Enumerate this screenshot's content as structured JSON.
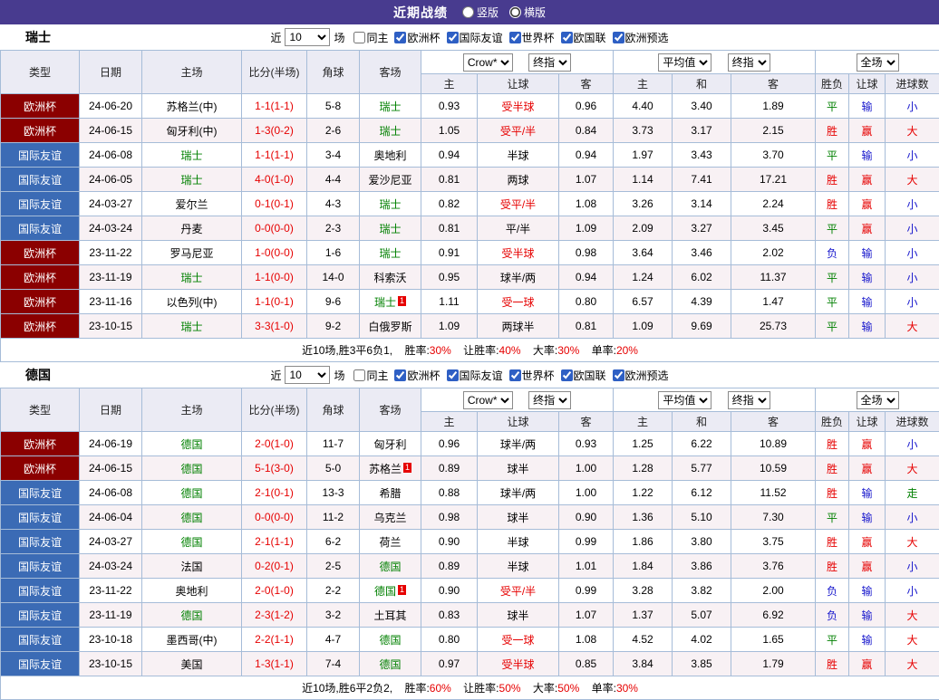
{
  "titlebar": {
    "title": "近期战绩",
    "view_options": [
      {
        "label": "竖版",
        "checked": false
      },
      {
        "label": "横版",
        "checked": true
      }
    ]
  },
  "filter_labels": {
    "recent": "近",
    "games": "场"
  },
  "selects": {
    "recent_count": "10",
    "bookmaker": "Crow*",
    "bookmaker_final": "终指",
    "average": "平均值",
    "average_final": "终指",
    "scope": "全场"
  },
  "table_headers": {
    "type": "类型",
    "date": "日期",
    "home": "主场",
    "score": "比分(半场)",
    "corner": "角球",
    "away": "客场",
    "odds_home": "主",
    "odds_handicap": "让球",
    "odds_away": "客",
    "avg_home": "主",
    "avg_draw": "和",
    "avg_away": "客",
    "result": "胜负",
    "handicap_result": "让球",
    "goals": "进球数"
  },
  "comp_colors": {
    "欧洲杯": "#8B0000",
    "国际友谊": "#3B6BB5"
  },
  "result_colors": {
    "win": "#E60000",
    "draw": "#008000",
    "lose": "#1515CC"
  },
  "sections": [
    {
      "team": "瑞士",
      "filters": [
        {
          "label": "同主",
          "checked": false
        },
        {
          "label": "欧洲杯",
          "checked": true
        },
        {
          "label": "国际友谊",
          "checked": true
        },
        {
          "label": "世界杯",
          "checked": true
        },
        {
          "label": "欧国联",
          "checked": true
        },
        {
          "label": "欧洲预选",
          "checked": true
        }
      ],
      "rows": [
        {
          "comp": "欧洲杯",
          "date": "24-06-20",
          "home": "苏格兰(中)",
          "score": "1-1(1-1)",
          "corner": "5-8",
          "away": "瑞士",
          "away_focus": true,
          "odds_home": "0.93",
          "handicap": "受半球",
          "handicap_recv": true,
          "odds_away": "0.96",
          "avg_home": "4.40",
          "avg_draw": "3.40",
          "avg_away": "1.89",
          "result": "平",
          "result_k": "draw",
          "asian": "输",
          "asian_k": "lose",
          "goals": "小",
          "goals_k": "lose"
        },
        {
          "comp": "欧洲杯",
          "date": "24-06-15",
          "home": "匈牙利(中)",
          "score": "1-3(0-2)",
          "corner": "2-6",
          "away": "瑞士",
          "away_focus": true,
          "odds_home": "1.05",
          "handicap": "受平/半",
          "handicap_recv": true,
          "odds_away": "0.84",
          "avg_home": "3.73",
          "avg_draw": "3.17",
          "avg_away": "2.15",
          "result": "胜",
          "result_k": "win",
          "asian": "赢",
          "asian_k": "win",
          "goals": "大",
          "goals_k": "win"
        },
        {
          "comp": "国际友谊",
          "date": "24-06-08",
          "home": "瑞士",
          "home_focus": true,
          "score": "1-1(1-1)",
          "corner": "3-4",
          "away": "奥地利",
          "odds_home": "0.94",
          "handicap": "半球",
          "odds_away": "0.94",
          "avg_home": "1.97",
          "avg_draw": "3.43",
          "avg_away": "3.70",
          "result": "平",
          "result_k": "draw",
          "asian": "输",
          "asian_k": "lose",
          "goals": "小",
          "goals_k": "lose"
        },
        {
          "comp": "国际友谊",
          "date": "24-06-05",
          "home": "瑞士",
          "home_focus": true,
          "score": "4-0(1-0)",
          "corner": "4-4",
          "away": "爱沙尼亚",
          "odds_home": "0.81",
          "handicap": "两球",
          "odds_away": "1.07",
          "avg_home": "1.14",
          "avg_draw": "7.41",
          "avg_away": "17.21",
          "result": "胜",
          "result_k": "win",
          "asian": "赢",
          "asian_k": "win",
          "goals": "大",
          "goals_k": "win"
        },
        {
          "comp": "国际友谊",
          "date": "24-03-27",
          "home": "爱尔兰",
          "score": "0-1(0-1)",
          "corner": "4-3",
          "away": "瑞士",
          "away_focus": true,
          "odds_home": "0.82",
          "handicap": "受平/半",
          "handicap_recv": true,
          "odds_away": "1.08",
          "avg_home": "3.26",
          "avg_draw": "3.14",
          "avg_away": "2.24",
          "result": "胜",
          "result_k": "win",
          "asian": "赢",
          "asian_k": "win",
          "goals": "小",
          "goals_k": "lose"
        },
        {
          "comp": "国际友谊",
          "date": "24-03-24",
          "home": "丹麦",
          "score": "0-0(0-0)",
          "corner": "2-3",
          "away": "瑞士",
          "away_focus": true,
          "odds_home": "0.81",
          "handicap": "平/半",
          "odds_away": "1.09",
          "avg_home": "2.09",
          "avg_draw": "3.27",
          "avg_away": "3.45",
          "result": "平",
          "result_k": "draw",
          "asian": "赢",
          "asian_k": "win",
          "goals": "小",
          "goals_k": "lose"
        },
        {
          "comp": "欧洲杯",
          "date": "23-11-22",
          "home": "罗马尼亚",
          "score": "1-0(0-0)",
          "corner": "1-6",
          "away": "瑞士",
          "away_focus": true,
          "odds_home": "0.91",
          "handicap": "受半球",
          "handicap_recv": true,
          "odds_away": "0.98",
          "avg_home": "3.64",
          "avg_draw": "3.46",
          "avg_away": "2.02",
          "result": "负",
          "result_k": "lose",
          "asian": "输",
          "asian_k": "lose",
          "goals": "小",
          "goals_k": "lose"
        },
        {
          "comp": "欧洲杯",
          "date": "23-11-19",
          "home": "瑞士",
          "home_focus": true,
          "score": "1-1(0-0)",
          "corner": "14-0",
          "away": "科索沃",
          "odds_home": "0.95",
          "handicap": "球半/两",
          "odds_away": "0.94",
          "avg_home": "1.24",
          "avg_draw": "6.02",
          "avg_away": "11.37",
          "result": "平",
          "result_k": "draw",
          "asian": "输",
          "asian_k": "lose",
          "goals": "小",
          "goals_k": "lose"
        },
        {
          "comp": "欧洲杯",
          "date": "23-11-16",
          "home": "以色列(中)",
          "score": "1-1(0-1)",
          "corner": "9-6",
          "away": "瑞士",
          "away_focus": true,
          "away_badge": "1",
          "odds_home": "1.11",
          "handicap": "受一球",
          "handicap_recv": true,
          "odds_away": "0.80",
          "avg_home": "6.57",
          "avg_draw": "4.39",
          "avg_away": "1.47",
          "result": "平",
          "result_k": "draw",
          "asian": "输",
          "asian_k": "lose",
          "goals": "小",
          "goals_k": "lose"
        },
        {
          "comp": "欧洲杯",
          "date": "23-10-15",
          "home": "瑞士",
          "home_focus": true,
          "score": "3-3(1-0)",
          "corner": "9-2",
          "away": "白俄罗斯",
          "odds_home": "1.09",
          "handicap": "两球半",
          "odds_away": "0.81",
          "avg_home": "1.09",
          "avg_draw": "9.69",
          "avg_away": "25.73",
          "result": "平",
          "result_k": "draw",
          "asian": "输",
          "asian_k": "lose",
          "goals": "大",
          "goals_k": "win"
        }
      ],
      "footer": {
        "summary": "近10场,胜3平6负1,",
        "stats": [
          {
            "label": "胜率:",
            "value": "30%"
          },
          {
            "label": "让胜率:",
            "value": "40%"
          },
          {
            "label": "大率:",
            "value": "30%"
          },
          {
            "label": "单率:",
            "value": "20%"
          }
        ]
      }
    },
    {
      "team": "德国",
      "filters": [
        {
          "label": "同主",
          "checked": false
        },
        {
          "label": "欧洲杯",
          "checked": true
        },
        {
          "label": "国际友谊",
          "checked": true
        },
        {
          "label": "世界杯",
          "checked": true
        },
        {
          "label": "欧国联",
          "checked": true
        },
        {
          "label": "欧洲预选",
          "checked": true
        }
      ],
      "rows": [
        {
          "comp": "欧洲杯",
          "date": "24-06-19",
          "home": "德国",
          "home_focus": true,
          "score": "2-0(1-0)",
          "corner": "11-7",
          "away": "匈牙利",
          "odds_home": "0.96",
          "handicap": "球半/两",
          "odds_away": "0.93",
          "avg_home": "1.25",
          "avg_draw": "6.22",
          "avg_away": "10.89",
          "result": "胜",
          "result_k": "win",
          "asian": "赢",
          "asian_k": "win",
          "goals": "小",
          "goals_k": "lose"
        },
        {
          "comp": "欧洲杯",
          "date": "24-06-15",
          "home": "德国",
          "home_focus": true,
          "score": "5-1(3-0)",
          "corner": "5-0",
          "away": "苏格兰",
          "away_badge": "1",
          "odds_home": "0.89",
          "handicap": "球半",
          "odds_away": "1.00",
          "avg_home": "1.28",
          "avg_draw": "5.77",
          "avg_away": "10.59",
          "result": "胜",
          "result_k": "win",
          "asian": "赢",
          "asian_k": "win",
          "goals": "大",
          "goals_k": "win"
        },
        {
          "comp": "国际友谊",
          "date": "24-06-08",
          "home": "德国",
          "home_focus": true,
          "score": "2-1(0-1)",
          "corner": "13-3",
          "away": "希腊",
          "odds_home": "0.88",
          "handicap": "球半/两",
          "odds_away": "1.00",
          "avg_home": "1.22",
          "avg_draw": "6.12",
          "avg_away": "11.52",
          "result": "胜",
          "result_k": "win",
          "asian": "输",
          "asian_k": "lose",
          "goals": "走",
          "goals_k": "draw"
        },
        {
          "comp": "国际友谊",
          "date": "24-06-04",
          "home": "德国",
          "home_focus": true,
          "score": "0-0(0-0)",
          "corner": "11-2",
          "away": "乌克兰",
          "odds_home": "0.98",
          "handicap": "球半",
          "odds_away": "0.90",
          "avg_home": "1.36",
          "avg_draw": "5.10",
          "avg_away": "7.30",
          "result": "平",
          "result_k": "draw",
          "asian": "输",
          "asian_k": "lose",
          "goals": "小",
          "goals_k": "lose"
        },
        {
          "comp": "国际友谊",
          "date": "24-03-27",
          "home": "德国",
          "home_focus": true,
          "score": "2-1(1-1)",
          "corner": "6-2",
          "away": "荷兰",
          "odds_home": "0.90",
          "handicap": "半球",
          "odds_away": "0.99",
          "avg_home": "1.86",
          "avg_draw": "3.80",
          "avg_away": "3.75",
          "result": "胜",
          "result_k": "win",
          "asian": "赢",
          "asian_k": "win",
          "goals": "大",
          "goals_k": "win"
        },
        {
          "comp": "国际友谊",
          "date": "24-03-24",
          "home": "法国",
          "score": "0-2(0-1)",
          "corner": "2-5",
          "away": "德国",
          "away_focus": true,
          "odds_home": "0.89",
          "handicap": "半球",
          "odds_away": "1.01",
          "avg_home": "1.84",
          "avg_draw": "3.86",
          "avg_away": "3.76",
          "result": "胜",
          "result_k": "win",
          "asian": "赢",
          "asian_k": "win",
          "goals": "小",
          "goals_k": "lose"
        },
        {
          "comp": "国际友谊",
          "date": "23-11-22",
          "home": "奥地利",
          "score": "2-0(1-0)",
          "corner": "2-2",
          "away": "德国",
          "away_focus": true,
          "away_badge": "1",
          "odds_home": "0.90",
          "handicap": "受平/半",
          "handicap_recv": true,
          "odds_away": "0.99",
          "avg_home": "3.28",
          "avg_draw": "3.82",
          "avg_away": "2.00",
          "result": "负",
          "result_k": "lose",
          "asian": "输",
          "asian_k": "lose",
          "goals": "小",
          "goals_k": "lose"
        },
        {
          "comp": "国际友谊",
          "date": "23-11-19",
          "home": "德国",
          "home_focus": true,
          "score": "2-3(1-2)",
          "corner": "3-2",
          "away": "土耳其",
          "odds_home": "0.83",
          "handicap": "球半",
          "odds_away": "1.07",
          "avg_home": "1.37",
          "avg_draw": "5.07",
          "avg_away": "6.92",
          "result": "负",
          "result_k": "lose",
          "asian": "输",
          "asian_k": "lose",
          "goals": "大",
          "goals_k": "win"
        },
        {
          "comp": "国际友谊",
          "date": "23-10-18",
          "home": "墨西哥(中)",
          "score": "2-2(1-1)",
          "corner": "4-7",
          "away": "德国",
          "away_focus": true,
          "odds_home": "0.80",
          "handicap": "受一球",
          "handicap_recv": true,
          "odds_away": "1.08",
          "avg_home": "4.52",
          "avg_draw": "4.02",
          "avg_away": "1.65",
          "result": "平",
          "result_k": "draw",
          "asian": "输",
          "asian_k": "lose",
          "goals": "大",
          "goals_k": "win"
        },
        {
          "comp": "国际友谊",
          "date": "23-10-15",
          "home": "美国",
          "score": "1-3(1-1)",
          "corner": "7-4",
          "away": "德国",
          "away_focus": true,
          "odds_home": "0.97",
          "handicap": "受半球",
          "handicap_recv": true,
          "odds_away": "0.85",
          "avg_home": "3.84",
          "avg_draw": "3.85",
          "avg_away": "1.79",
          "result": "胜",
          "result_k": "win",
          "asian": "赢",
          "asian_k": "win",
          "goals": "大",
          "goals_k": "win"
        }
      ],
      "footer": {
        "summary": "近10场,胜6平2负2,",
        "stats": [
          {
            "label": "胜率:",
            "value": "60%"
          },
          {
            "label": "让胜率:",
            "value": "50%"
          },
          {
            "label": "大率:",
            "value": "50%"
          },
          {
            "label": "单率:",
            "value": "30%"
          }
        ]
      }
    }
  ]
}
